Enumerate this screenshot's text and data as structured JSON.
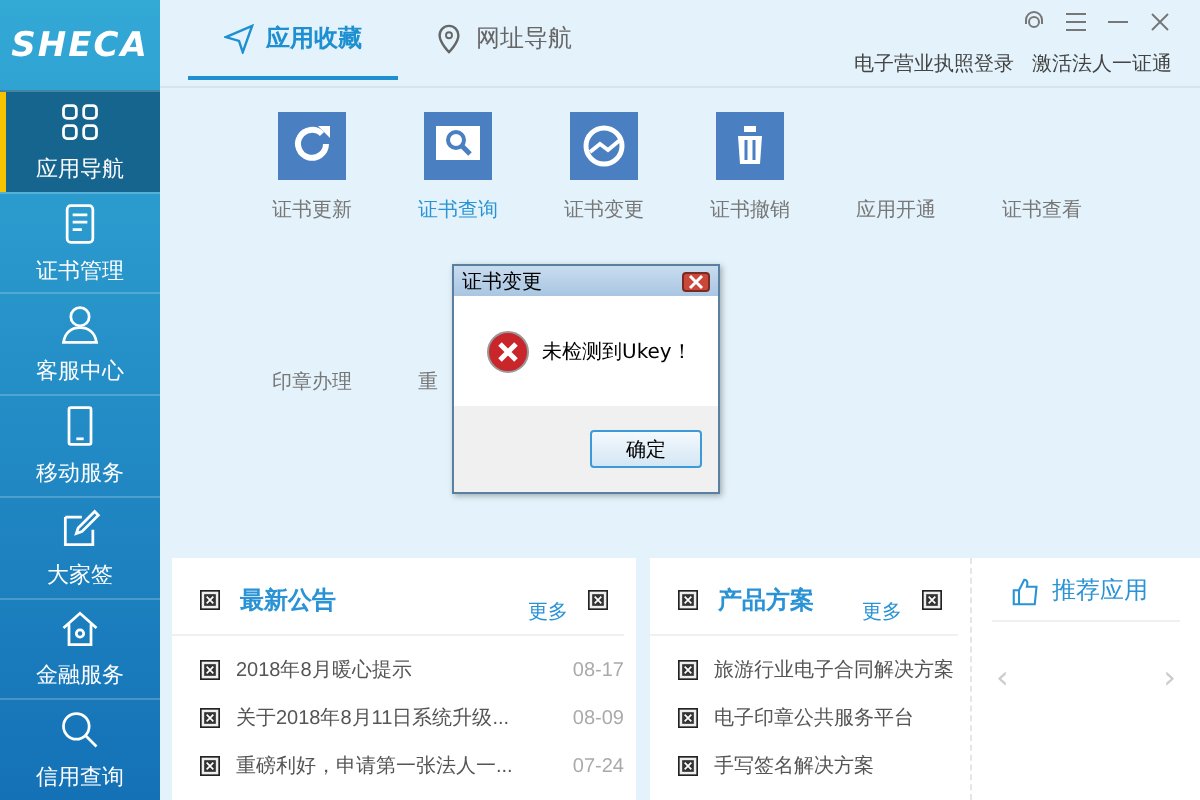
{
  "sidebar": {
    "logo": "SHECA",
    "items": [
      {
        "label": "应用导航",
        "selected": true
      },
      {
        "label": "证书管理",
        "selected": false
      },
      {
        "label": "客服中心",
        "selected": false
      },
      {
        "label": "移动服务",
        "selected": false
      },
      {
        "label": "大家签",
        "selected": false
      },
      {
        "label": "金融服务",
        "selected": false
      },
      {
        "label": "信用查询",
        "selected": false
      }
    ]
  },
  "tabs": [
    {
      "label": "应用收藏",
      "selected": true
    },
    {
      "label": "网址导航",
      "selected": false
    }
  ],
  "header_links": [
    "电子营业执照登录",
    "激活法人一证通"
  ],
  "apps": [
    {
      "label": "证书更新",
      "has_icon": true,
      "selected": false
    },
    {
      "label": "证书查询",
      "has_icon": true,
      "selected": true
    },
    {
      "label": "证书变更",
      "has_icon": true,
      "selected": false
    },
    {
      "label": "证书撤销",
      "has_icon": true,
      "selected": false
    },
    {
      "label": "应用开通",
      "has_icon": false,
      "selected": false
    },
    {
      "label": "证书查看",
      "has_icon": false,
      "selected": false
    },
    {
      "label": "印章办理",
      "has_icon": false,
      "selected": false
    },
    {
      "label": "重",
      "has_icon": false,
      "selected": false
    }
  ],
  "dialog": {
    "title": "证书变更",
    "message": "未检测到Ukey！",
    "button": "确定"
  },
  "news": {
    "title": "最新公告",
    "more": "更多",
    "items": [
      {
        "text": "2018年8月暖心提示",
        "date": "08-17"
      },
      {
        "text": "关于2018年8月11日系统升级...",
        "date": "08-09"
      },
      {
        "text": "重磅利好，申请第一张法人一...",
        "date": "07-24"
      }
    ]
  },
  "products": {
    "title": "产品方案",
    "more": "更多",
    "items": [
      "旅游行业电子合同解决方案",
      "电子印章公共服务平台",
      "手写签名解决方案"
    ]
  },
  "recommend": {
    "title": "推荐应用",
    "prev": "‹",
    "next": "›"
  }
}
